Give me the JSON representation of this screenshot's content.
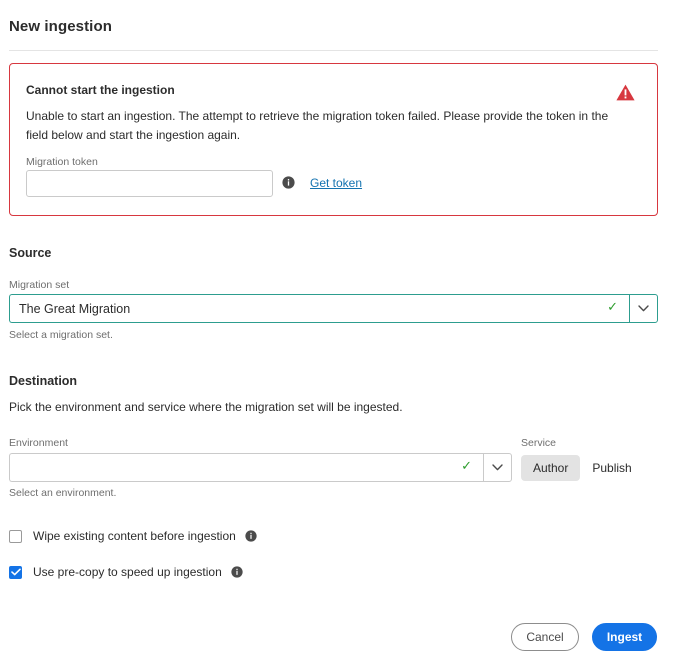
{
  "header": {
    "title": "New ingestion"
  },
  "alert": {
    "title": "Cannot start the ingestion",
    "body": "Unable to start an ingestion. The attempt to retrieve the migration token failed. Please provide the token in the field below and start the ingestion again.",
    "icon": "warning-triangle-icon",
    "token_label": "Migration token",
    "token_value": "",
    "token_placeholder": "",
    "token_info_icon": "info-icon",
    "get_token_link": "Get token",
    "border_color": "#d7373f",
    "icon_color": "#d7373f"
  },
  "source": {
    "heading": "Source",
    "migration_set_label": "Migration set",
    "migration_set_value": "The Great Migration",
    "migration_set_help": "Select a migration set.",
    "valid_icon": "check-icon",
    "caret_icon": "chevron-down-icon",
    "focus_color": "#2d9d8f",
    "valid_color": "#2d9d2d"
  },
  "destination": {
    "heading": "Destination",
    "description": "Pick the environment and service where the migration set will be ingested.",
    "environment_label": "Environment",
    "environment_value": "",
    "environment_help": "Select an environment.",
    "valid_icon": "check-icon",
    "caret_icon": "chevron-down-icon",
    "service_label": "Service",
    "service_options": [
      {
        "label": "Author",
        "selected": true
      },
      {
        "label": "Publish",
        "selected": false
      }
    ]
  },
  "options": [
    {
      "label": "Wipe existing content before ingestion",
      "checked": false,
      "info_icon": "info-icon"
    },
    {
      "label": "Use pre-copy to speed up ingestion",
      "checked": true,
      "info_icon": "info-icon"
    }
  ],
  "footer": {
    "cancel_label": "Cancel",
    "ingest_label": "Ingest",
    "accent_color": "#1473e6"
  }
}
